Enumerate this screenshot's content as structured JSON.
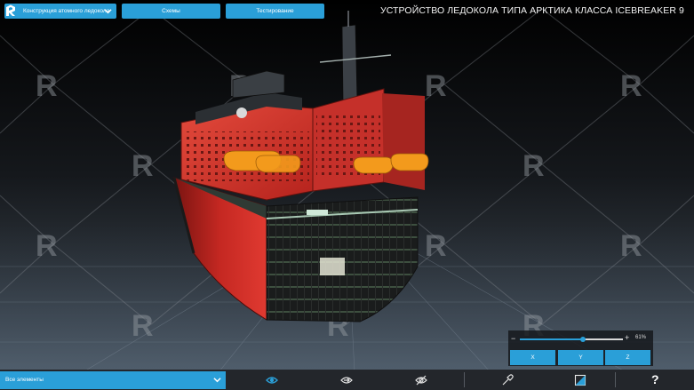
{
  "header": {
    "section_select": "Конструкция атомного ледокола",
    "tabs": [
      {
        "label": "Схемы"
      },
      {
        "label": "Тестирование"
      }
    ],
    "title": "УСТРОЙСТВО ЛЕДОКОЛА ТИПА АРКТИКА КЛАССА ICEBREAKER 9"
  },
  "section_plane": {
    "minus": "−",
    "plus": "+",
    "value_label": "61%",
    "value": 0.61,
    "axes": [
      {
        "label": "X"
      },
      {
        "label": "Y"
      },
      {
        "label": "Z"
      }
    ]
  },
  "toolbar": {
    "elements_select": "Все элементы",
    "help": "?",
    "icons": [
      "eye-icon",
      "eye-arrow-icon",
      "eye-off-icon",
      "eyedropper-icon",
      "opacity-icon"
    ]
  },
  "colors": {
    "accent": "#2a9fd8",
    "hull_red": "#d8302a",
    "lifeboat_orange": "#f39a1c"
  }
}
